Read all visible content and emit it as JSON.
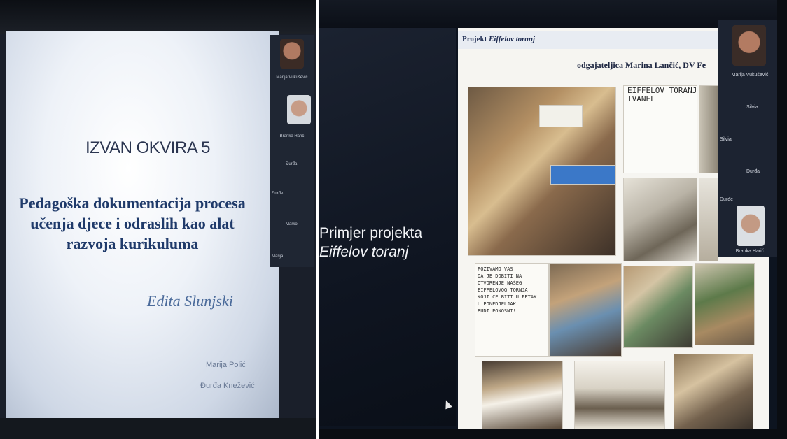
{
  "left_slide": {
    "title": "IZVAN OKVIRA 5",
    "subtitle_lines": [
      "Pedagoška dokumentacija procesa",
      "učenja djece i odraslih kao alat",
      "razvoja kurikuluma"
    ],
    "author": "Edita Slunjski",
    "credits": [
      "Marija Polić",
      "Đurđa Knežević"
    ]
  },
  "left_participants": [
    {
      "label": "Marija Vukušević"
    },
    {
      "label": "Branka Harić"
    },
    {
      "label": "Đurđa"
    },
    {
      "label": "Đurđe"
    },
    {
      "label": "Marko"
    },
    {
      "label": "Marija"
    }
  ],
  "right_slide": {
    "heading_line1": "Primjer projekta",
    "heading_line2": "Eiffelov toranj",
    "project_title_prefix": "Projekt ",
    "project_title_italic": "Eiffelov toranj",
    "teacher": "odgajateljica Marina Lančić, DV Fe",
    "note_top": "EIFFELOV TORANJ\nIVANEL",
    "note_bottom": "POZIVAMO VAS\nDA JE DOBITI NA\nOTVORENJE NAŠEG\nEIFFELOVOG TORNJA\nKOJI ĆE BITI U PETAK\nU PONEDJELJAK\nBUDI PONOSNI!"
  },
  "right_participants": [
    {
      "label": "Marija Vukušević"
    },
    {
      "label": "Silvia"
    },
    {
      "label": "Silvia"
    },
    {
      "label": "Đurđa"
    },
    {
      "label": "Đurđe"
    },
    {
      "label": "Branka Harić"
    }
  ]
}
